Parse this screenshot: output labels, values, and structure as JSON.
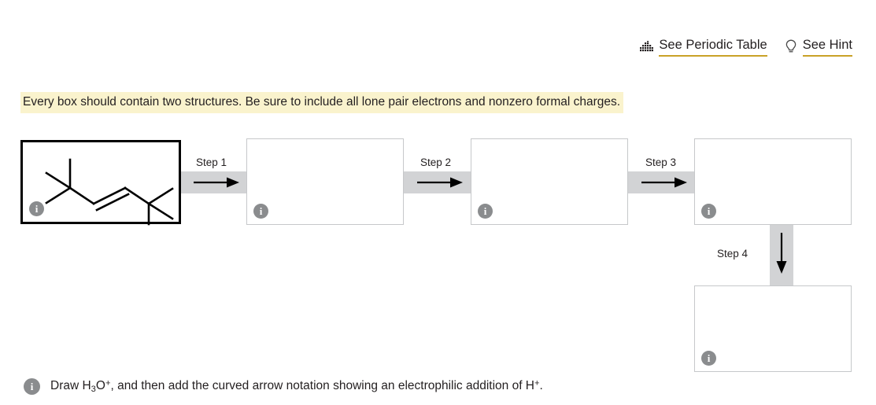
{
  "header": {
    "periodic_table_link": "See Periodic Table",
    "hint_link": "See Hint",
    "periodic_table_icon": "periodic-table-icon",
    "hint_icon": "lightbulb-icon",
    "underline_color": "#c9a227"
  },
  "instruction": {
    "text": "Every box should contain two structures. Be sure to include all lone pair electrons and nonzero formal charges.",
    "highlight_color": "#faf3cd"
  },
  "steps": [
    {
      "label": "Step 1",
      "direction": "right"
    },
    {
      "label": "Step 2",
      "direction": "right"
    },
    {
      "label": "Step 3",
      "direction": "right"
    },
    {
      "label": "Step 4",
      "direction": "down"
    }
  ],
  "boxes": [
    {
      "name": "starting-structure-box",
      "filled": true,
      "info": "i"
    },
    {
      "name": "step1-answer-box",
      "filled": false,
      "info": "i"
    },
    {
      "name": "step2-answer-box",
      "filled": false,
      "info": "i"
    },
    {
      "name": "step3-answer-box",
      "filled": false,
      "info": "i"
    },
    {
      "name": "step4-answer-box",
      "filled": false,
      "info": "i"
    }
  ],
  "structure": {
    "name": "2,2,5,5-tetramethyl-3-hexene",
    "bond_color": "#000000"
  },
  "footer": {
    "info_icon": "info-icon",
    "text_part1": "Draw H",
    "text_sub1": "3",
    "text_part2": "O",
    "text_sup1": "+",
    "text_part3": ", and then add the curved arrow notation showing an electrophilic addition of H",
    "text_sup2": "+",
    "text_part4": "."
  }
}
